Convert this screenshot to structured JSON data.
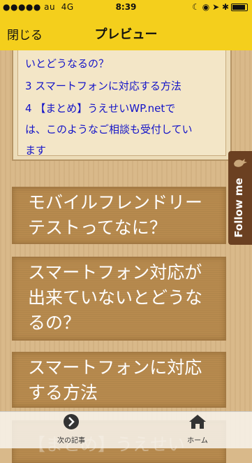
{
  "status": {
    "signal": "●●●●● au",
    "network": "4G",
    "time": "8:39",
    "right_icons": "☾ ◉ ➤ ✱"
  },
  "nav": {
    "close_label": "閉じる",
    "title": "プレビュー"
  },
  "toc": {
    "lines": [
      "いとどうなるの？",
      "3 スマートフォンに対応する方法",
      "4 【まとめ】うえせいWP.netで",
      "は、このようなご相談も受付してい",
      "ます"
    ]
  },
  "headlines": [
    {
      "line1": "モバイルフレンドリー",
      "line2": "テストってなに？",
      "line3": ""
    },
    {
      "line1": "スマートフォン対応が",
      "line2": "出来ていないとどうな",
      "line3": "るの？"
    },
    {
      "line1": "スマートフォンに対応",
      "line2": "する方法",
      "line3": ""
    }
  ],
  "under_text": "【まとめ】うえせい",
  "follow": {
    "label": "Follow me"
  },
  "tabbar": {
    "next_label": "次の記事",
    "home_label": "ホーム"
  }
}
